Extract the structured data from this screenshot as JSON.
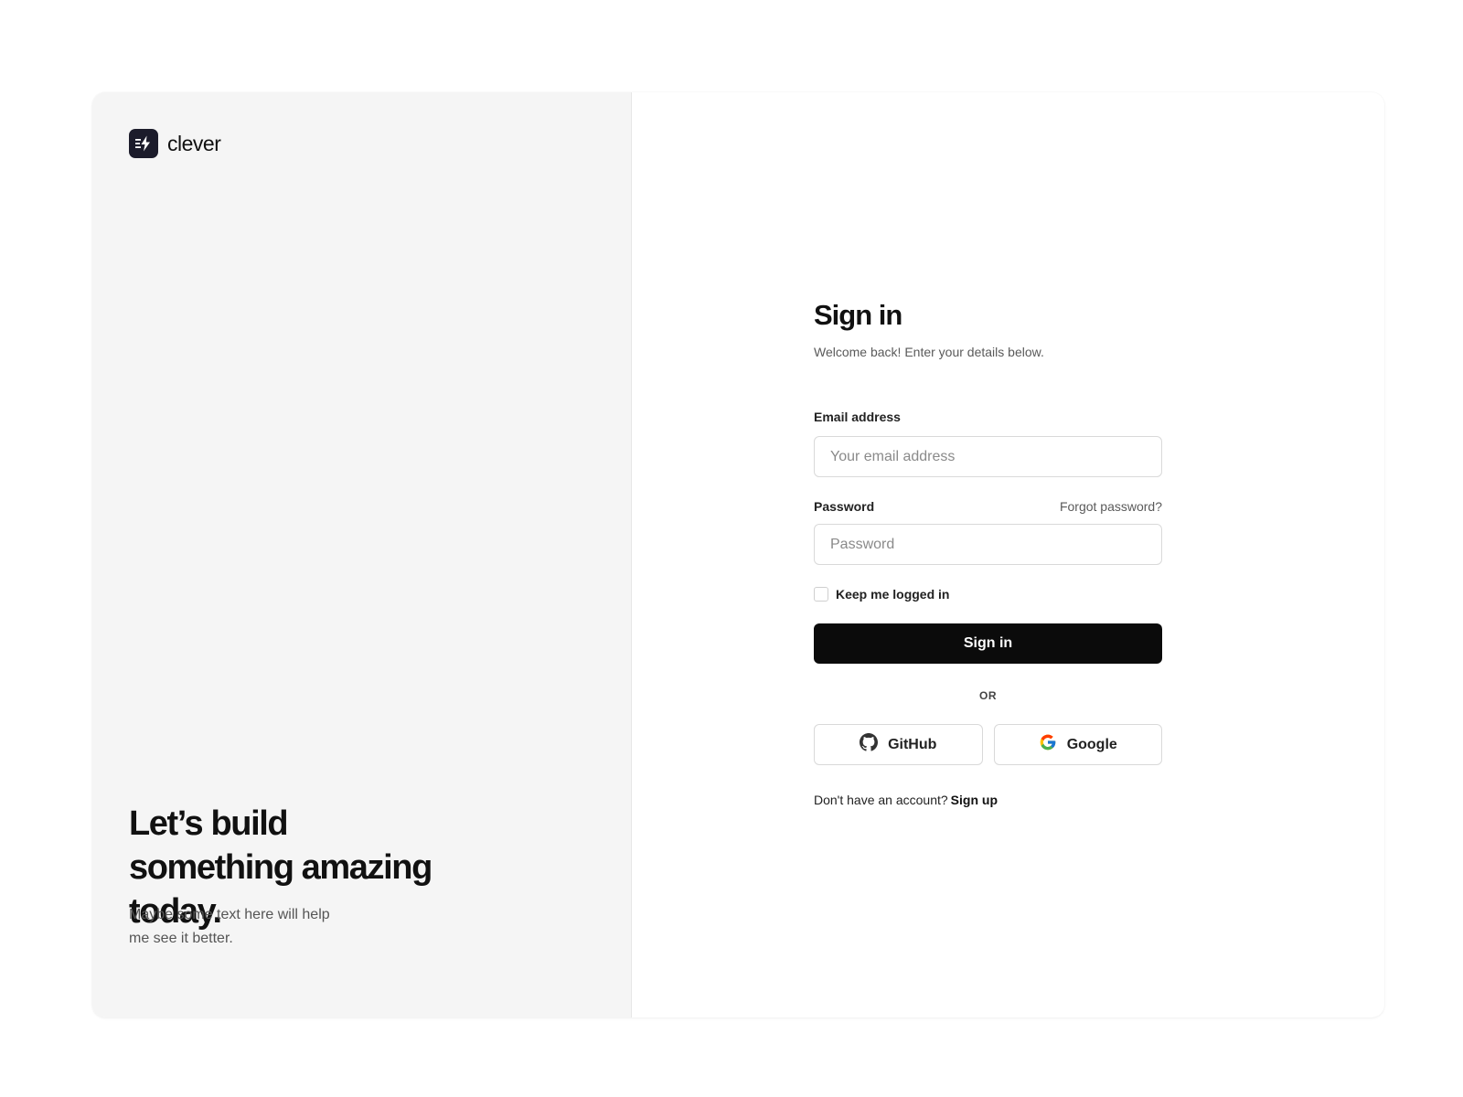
{
  "brand": {
    "name": "clever",
    "logo_icon": "bolt-logo-icon"
  },
  "hero": {
    "title": "Let’s build something amazing today.",
    "subtitle": "Maybe some text here will help me see it better."
  },
  "form": {
    "title": "Sign in",
    "subtitle": "Welcome back! Enter your details below.",
    "email_label": "Email address",
    "email_placeholder": "Your email address",
    "email_value": "",
    "password_label": "Password",
    "forgot_label": "Forgot password?",
    "password_placeholder": "Password",
    "password_value": "",
    "remember_label": "Keep me logged in",
    "remember_checked": false,
    "submit_label": "Sign in",
    "divider_label": "OR",
    "github_label": "GitHub",
    "github_icon": "github-icon",
    "google_label": "Google",
    "google_icon": "google-icon",
    "signup_prompt": "Don't have an account?",
    "signup_label": "Sign up"
  },
  "colors": {
    "left_panel_bg": "#f5f5f5",
    "primary_button": "#0b0b0b",
    "logo_bg": "#1c1c2b"
  }
}
